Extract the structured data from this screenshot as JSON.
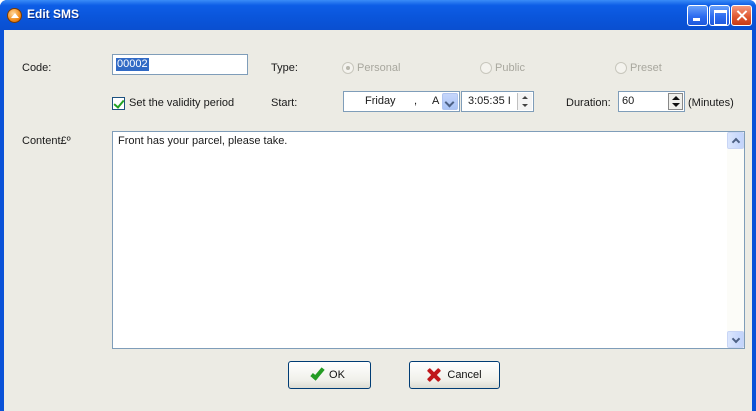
{
  "window": {
    "title": "Edit SMS"
  },
  "form": {
    "code_label": "Code:",
    "code_value": "00002",
    "type_label": "Type:",
    "type_options": [
      "Personal",
      "Public",
      "Preset"
    ],
    "type_selected": "Personal",
    "validity_label": "Set the validity period",
    "validity_checked": true,
    "start_label": "Start:",
    "start_day": "Friday",
    "start_sep": ",",
    "start_month": "A",
    "start_time": "3:05:35 I",
    "duration_label": "Duration:",
    "duration_value": "60",
    "duration_unit": "(Minutes)",
    "content_label": "Content£º",
    "content_value": "Front has your parcel, please take."
  },
  "buttons": {
    "ok_label": "OK",
    "cancel_label": "Cancel"
  },
  "colors": {
    "titlebar": "#0a55da",
    "client_bg": "#ecebe4",
    "selection": "#316ac5",
    "ok_icon": "#249c24",
    "cancel_icon": "#c0161a"
  },
  "icons": {
    "app": "app-icon",
    "minimize": "minimize-icon",
    "maximize": "maximize-icon",
    "close": "close-icon",
    "ok": "checkmark-icon",
    "cancel": "x-icon"
  }
}
